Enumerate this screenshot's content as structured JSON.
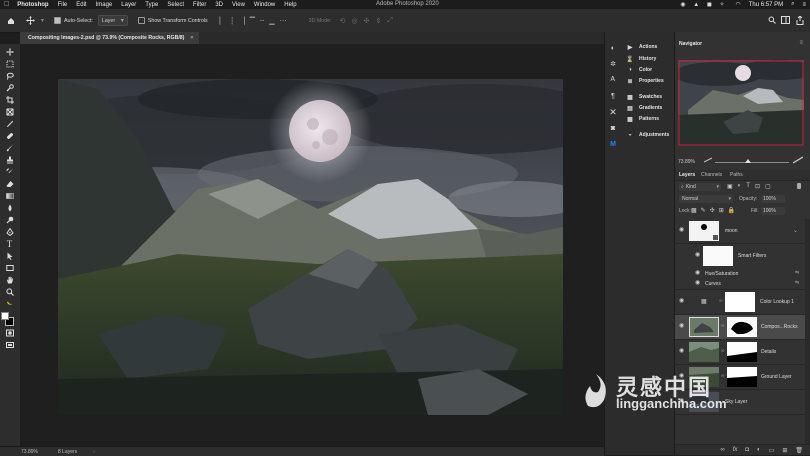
{
  "menubar": {
    "app_name": "Photoshop",
    "items": [
      "File",
      "Edit",
      "Image",
      "Layer",
      "Type",
      "Select",
      "Filter",
      "3D",
      "View",
      "Window",
      "Help"
    ],
    "window_title": "Adobe Photoshop 2020",
    "clock": "Thu 6:57 PM"
  },
  "options_bar": {
    "auto_select_label": "Auto-Select:",
    "auto_select_value": "Layer",
    "show_transform_label": "Show Transform Controls",
    "mode_3d_label": "3D Mode:"
  },
  "document": {
    "tab_title": "Compositing Images-2.psd @ 73.9% (Composite Rocks, RGB/8)"
  },
  "status_bar": {
    "zoom": "73.89%",
    "info": "8 Layers"
  },
  "panels_strip": {
    "groups": [
      [
        "Actions",
        "History",
        "Color",
        "Properties"
      ],
      [
        "Swatches",
        "Gradients",
        "Patterns"
      ],
      [
        "Adjustments"
      ]
    ]
  },
  "navigator": {
    "title": "Navigator",
    "zoom": "73.89%"
  },
  "layers_panel": {
    "tabs": [
      "Layers",
      "Channels",
      "Paths"
    ],
    "filter_kind": "Kind",
    "blend_mode": "Normal",
    "opacity_label": "Opacity:",
    "opacity_value": "100%",
    "lock_label": "Lock:",
    "fill_label": "Fill:",
    "fill_value": "100%",
    "layers": [
      {
        "name": "moon"
      },
      {
        "name": "Smart Filters"
      },
      {
        "name": "Hue/Saturation"
      },
      {
        "name": "Curves"
      },
      {
        "name": "Color Lookup 1"
      },
      {
        "name": "Compos...Rocks"
      },
      {
        "name": "Details"
      },
      {
        "name": "Ground Layer"
      },
      {
        "name": "Sky Layer"
      }
    ]
  },
  "watermark": {
    "title": "灵感中国",
    "url": "lingganchina.com"
  },
  "colors": {
    "accent_blue": "#1f86ff",
    "navigator_frame": "#d0213f",
    "active_layer": "#4a4a4a"
  }
}
